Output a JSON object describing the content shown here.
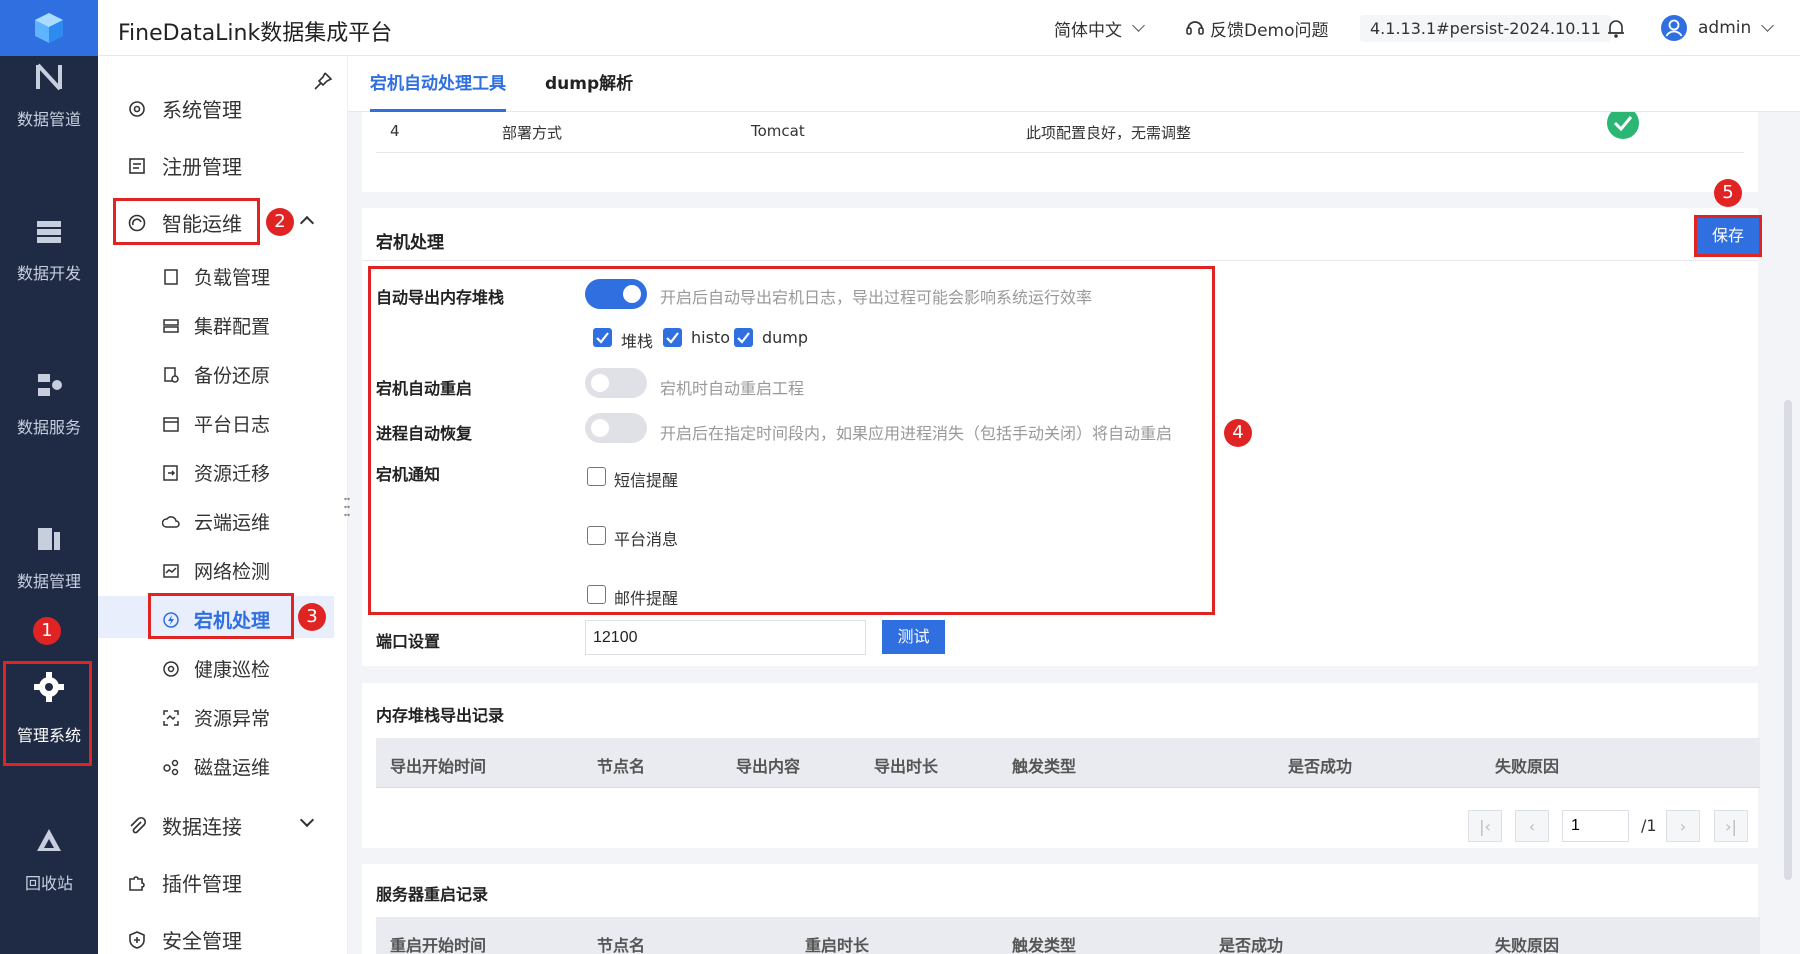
{
  "header": {
    "title": "FineDataLink数据集成平台",
    "language": "简体中文",
    "feedback": "反馈Demo问题",
    "version": "4.1.13.1#persist-2024.10.11",
    "user": "admin"
  },
  "rail": {
    "items": [
      {
        "label": "数据管道",
        "icon": "pipeline-icon"
      },
      {
        "label": "数据开发",
        "icon": "dev-icon"
      },
      {
        "label": "数据服务",
        "icon": "service-icon"
      },
      {
        "label": "数据管理",
        "icon": "manage-icon"
      },
      {
        "label": "管理系统",
        "icon": "gear-icon"
      },
      {
        "label": "回收站",
        "icon": "recycle-icon"
      }
    ]
  },
  "sidebar": {
    "system": "系统管理",
    "register": "注册管理",
    "ops": "智能运维",
    "sub": [
      "负载管理",
      "集群配置",
      "备份还原",
      "平台日志",
      "资源迁移",
      "云端运维",
      "网络检测",
      "宕机处理",
      "健康巡检",
      "资源异常",
      "磁盘运维"
    ],
    "connection": "数据连接",
    "plugin": "插件管理",
    "security": "安全管理"
  },
  "tabs": [
    "宕机自动处理工具",
    "dump解析"
  ],
  "top_row": {
    "no": "4",
    "item": "部署方式",
    "value": "Tomcat",
    "result": "此项配置良好，无需调整"
  },
  "crash": {
    "section_title": "宕机处理",
    "save_label": "保存",
    "auto_dump_label": "自动导出内存堆栈",
    "auto_dump_hint": "开启后自动导出宕机日志，导出过程可能会影响系统运行效率",
    "dump_options": [
      "堆栈",
      "histo",
      "dump"
    ],
    "auto_restart_label": "宕机自动重启",
    "auto_restart_hint": "宕机时自动重启工程",
    "auto_recover_label": "进程自动恢复",
    "auto_recover_hint": "开启后在指定时间段内，如果应用进程消失（包括手动关闭）将自动重启",
    "notify_label": "宕机通知",
    "notify_options": [
      "短信提醒",
      "平台消息",
      "邮件提醒"
    ],
    "port_label": "端口设置",
    "port_value": "12100",
    "test_label": "测试"
  },
  "dump_records": {
    "title": "内存堆栈导出记录",
    "columns": [
      "导出开始时间",
      "节点名",
      "导出内容",
      "导出时长",
      "触发类型",
      "是否成功",
      "失败原因"
    ],
    "page_value": "1",
    "page_total": "/1"
  },
  "restart_records": {
    "title": "服务器重启记录",
    "columns": [
      "重启开始时间",
      "节点名",
      "重启时长",
      "触发类型",
      "是否成功",
      "失败原因"
    ]
  },
  "badges": [
    "1",
    "2",
    "3",
    "4",
    "5"
  ]
}
